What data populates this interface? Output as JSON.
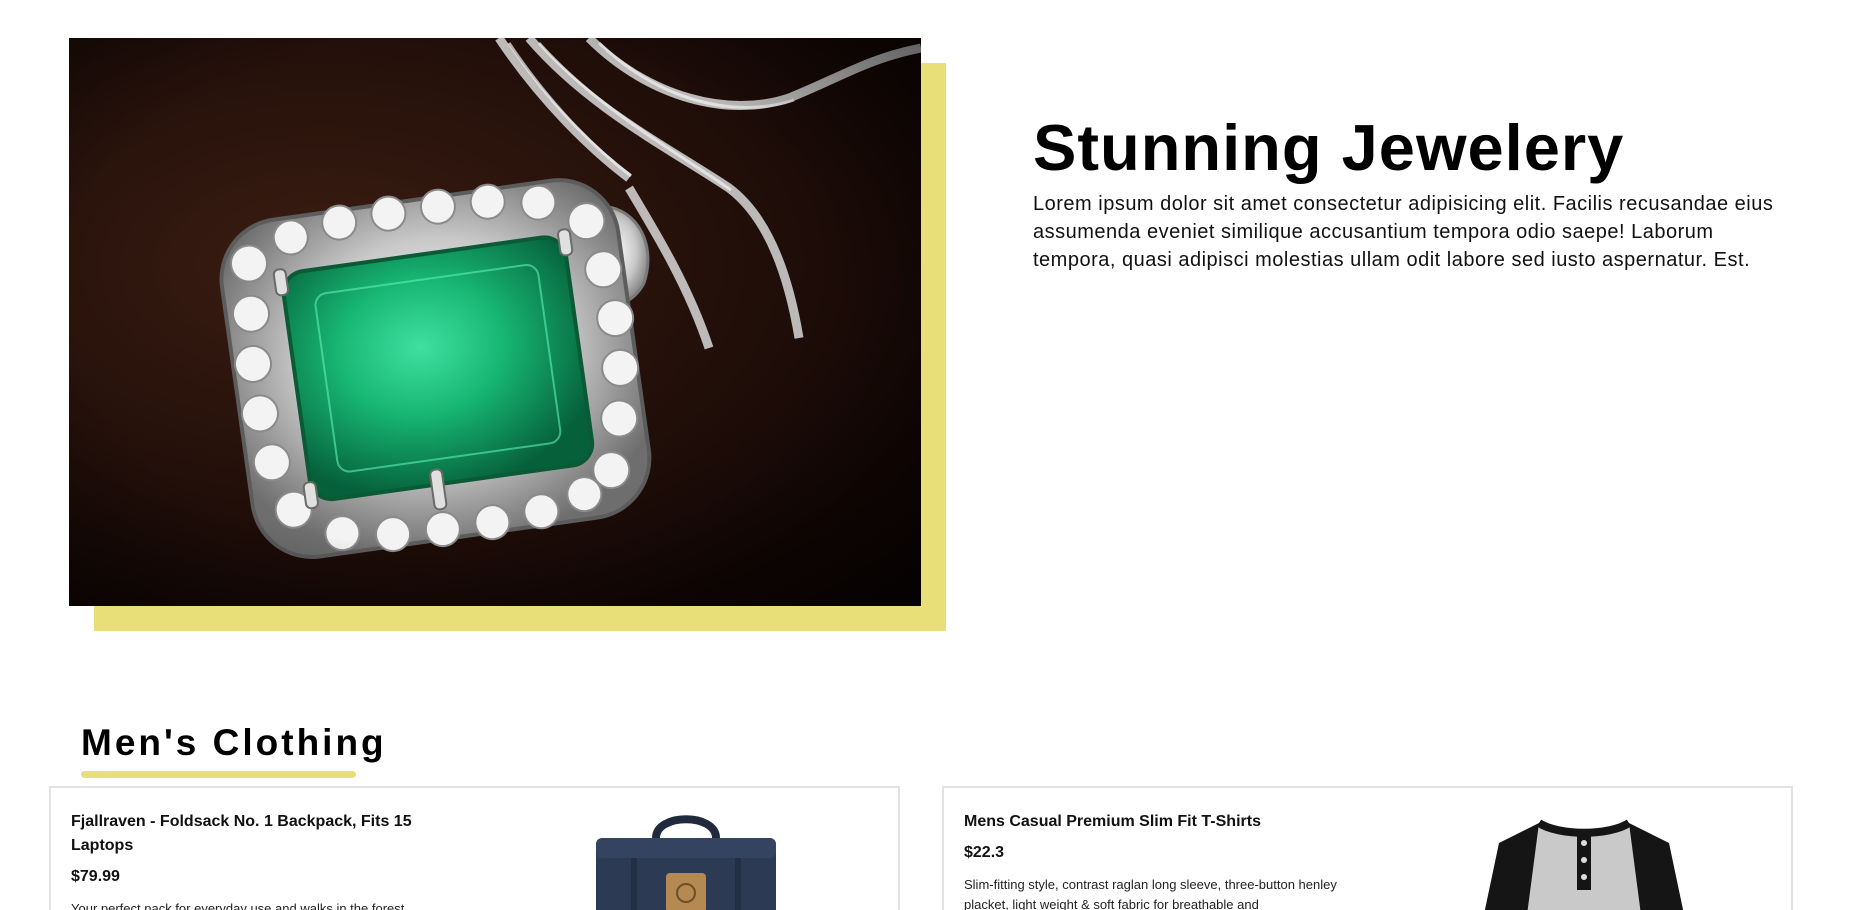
{
  "theme": {
    "accent": "#e8df78"
  },
  "hero": {
    "image_icon": "emerald-pendant-photo",
    "title": "Stunning Jewelery",
    "text": "Lorem ipsum dolor sit amet consectetur adipisicing elit. Facilis recusandae eius assumenda eveniet similique accusantium tempora odio saepe! Laborum tempora, quasi adipisci molestias ullam odit labore sed iusto aspernatur. Est."
  },
  "section": {
    "title": "Men's Clothing",
    "products": [
      {
        "title": "Fjallraven - Foldsack No. 1 Backpack, Fits 15 Laptops",
        "price": "$79.99",
        "description": "Your perfect pack for everyday use and walks in the forest.",
        "image_icon": "backpack-photo"
      },
      {
        "title": "Mens Casual Premium Slim Fit T-Shirts",
        "price": "$22.3",
        "description": "Slim-fitting style, contrast raglan long sleeve, three-button henley placket, light weight & soft fabric for breathable and",
        "image_icon": "tshirt-photo"
      }
    ]
  }
}
